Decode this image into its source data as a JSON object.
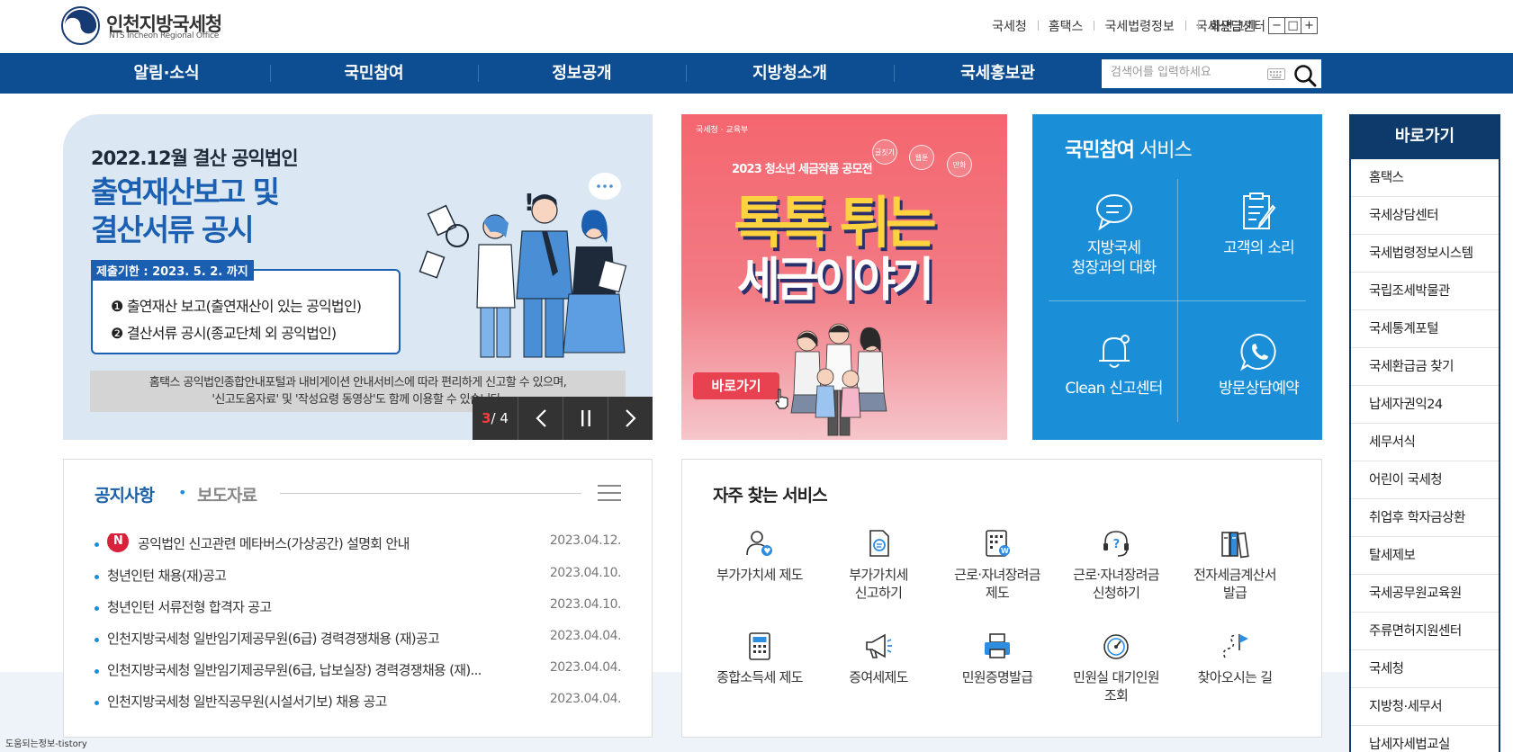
{
  "header": {
    "logo_ko": "인천지방국세청",
    "logo_en": "NTS Incheon Regional Office",
    "util_links": [
      "국세청",
      "홈택스",
      "국세법령정보",
      "국세상담센터"
    ],
    "font_size_label": "화면크기",
    "font_minus": "−",
    "font_reset": "□",
    "font_plus": "+"
  },
  "nav": {
    "items": [
      "알림·소식",
      "국민참여",
      "정보공개",
      "지방청소개",
      "국세홍보관"
    ],
    "search_placeholder": "검색어를 입력하세요"
  },
  "banner1": {
    "subtitle": "2022.12월 결산 공익법인",
    "title_line1": "출연재산보고 및",
    "title_line2": "결산서류 공시",
    "deadline": "제출기한 : 2023. 5. 2. 까지",
    "item1": "❶ 출연재산 보고(출연재산이 있는 공익법인)",
    "item2": "❷ 결산서류 공시(종교단체 외 공익법인)",
    "note_line1": "홈택스 공익법인종합안내포털과 내비게이션 안내서비스에 따라 편리하게 신고할 수 있으며,",
    "note_line2": "'신고도움자료' 및 '작성요령 동영상'도 함께 이용할 수 있습니다."
  },
  "slider": {
    "current": "3",
    "total": " / 4"
  },
  "banner2": {
    "org": "국세청 · 교육부",
    "contest": "2023 청소년 세금작품 공모전",
    "title_line1": "톡톡 튀는",
    "title_line2": "세금이야기",
    "go_button": "바로가기",
    "bubbles": [
      "글짓기",
      "웹툰",
      "만화"
    ]
  },
  "service": {
    "title_bold": "국민참여",
    "title_rest": " 서비스",
    "cells": [
      {
        "line1": "지방국세",
        "line2": "청장과의 대화"
      },
      {
        "line1": "고객의 소리",
        "line2": ""
      },
      {
        "line1": "Clean 신고센터",
        "line2": ""
      },
      {
        "line1": "방문상담예약",
        "line2": ""
      }
    ]
  },
  "quick": {
    "title": "바로가기",
    "items": [
      "홈택스",
      "국세상담센터",
      "국세법령정보시스템",
      "국립조세박물관",
      "국세통계포털",
      "국세환급금 찾기",
      "납세자권익24",
      "세무서식",
      "어린이 국세청",
      "취업후 학자금상환",
      "탈세제보",
      "국세공무원교육원",
      "주류면허지원센터",
      "국세청",
      "지방청·세무서",
      "납세자세법교실"
    ]
  },
  "notice": {
    "tab_active": "공지사항",
    "tab_dot": "•",
    "tab_inactive": "보도자료",
    "new_badge": "N",
    "rows": [
      {
        "title": "공익법인 신고관련 메타버스(가상공간) 설명회 안내",
        "date": "2023.04.12."
      },
      {
        "title": "청년인턴 채용(재)공고",
        "date": "2023.04.10."
      },
      {
        "title": "청년인턴 서류전형 합격자 공고",
        "date": "2023.04.10."
      },
      {
        "title": "인천지방국세청 일반임기제공무원(6급) 경력경쟁채용 (재)공고",
        "date": "2023.04.04."
      },
      {
        "title": "인천지방국세청 일반임기제공무원(6급, 납보실장) 경력경쟁채용 (재)...",
        "date": "2023.04.04."
      },
      {
        "title": "인천지방국세청 일반직공무원(시설서기보) 채용 공고",
        "date": "2023.04.04."
      }
    ]
  },
  "freq": {
    "title": "자주 찾는 서비스",
    "items": [
      {
        "line1": "부가가치세 제도",
        "line2": ""
      },
      {
        "line1": "부가가치세",
        "line2": "신고하기"
      },
      {
        "line1": "근로·자녀장려금",
        "line2": "제도"
      },
      {
        "line1": "근로·자녀장려금",
        "line2": "신청하기"
      },
      {
        "line1": "전자세금계산서",
        "line2": "발급"
      },
      {
        "line1": "종합소득세 제도",
        "line2": ""
      },
      {
        "line1": "증여세제도",
        "line2": ""
      },
      {
        "line1": "민원증명발급",
        "line2": ""
      },
      {
        "line1": "민원실 대기인원",
        "line2": "조회"
      },
      {
        "line1": "찾아오시는 길",
        "line2": ""
      }
    ]
  },
  "watermark": "도움되는정보-tistory",
  "colors": {
    "nav": "#0d4d91",
    "service": "#1a8fd8",
    "quick": "#0d3a6b",
    "banner2": "#f4666f",
    "new_badge": "#d8213a"
  }
}
